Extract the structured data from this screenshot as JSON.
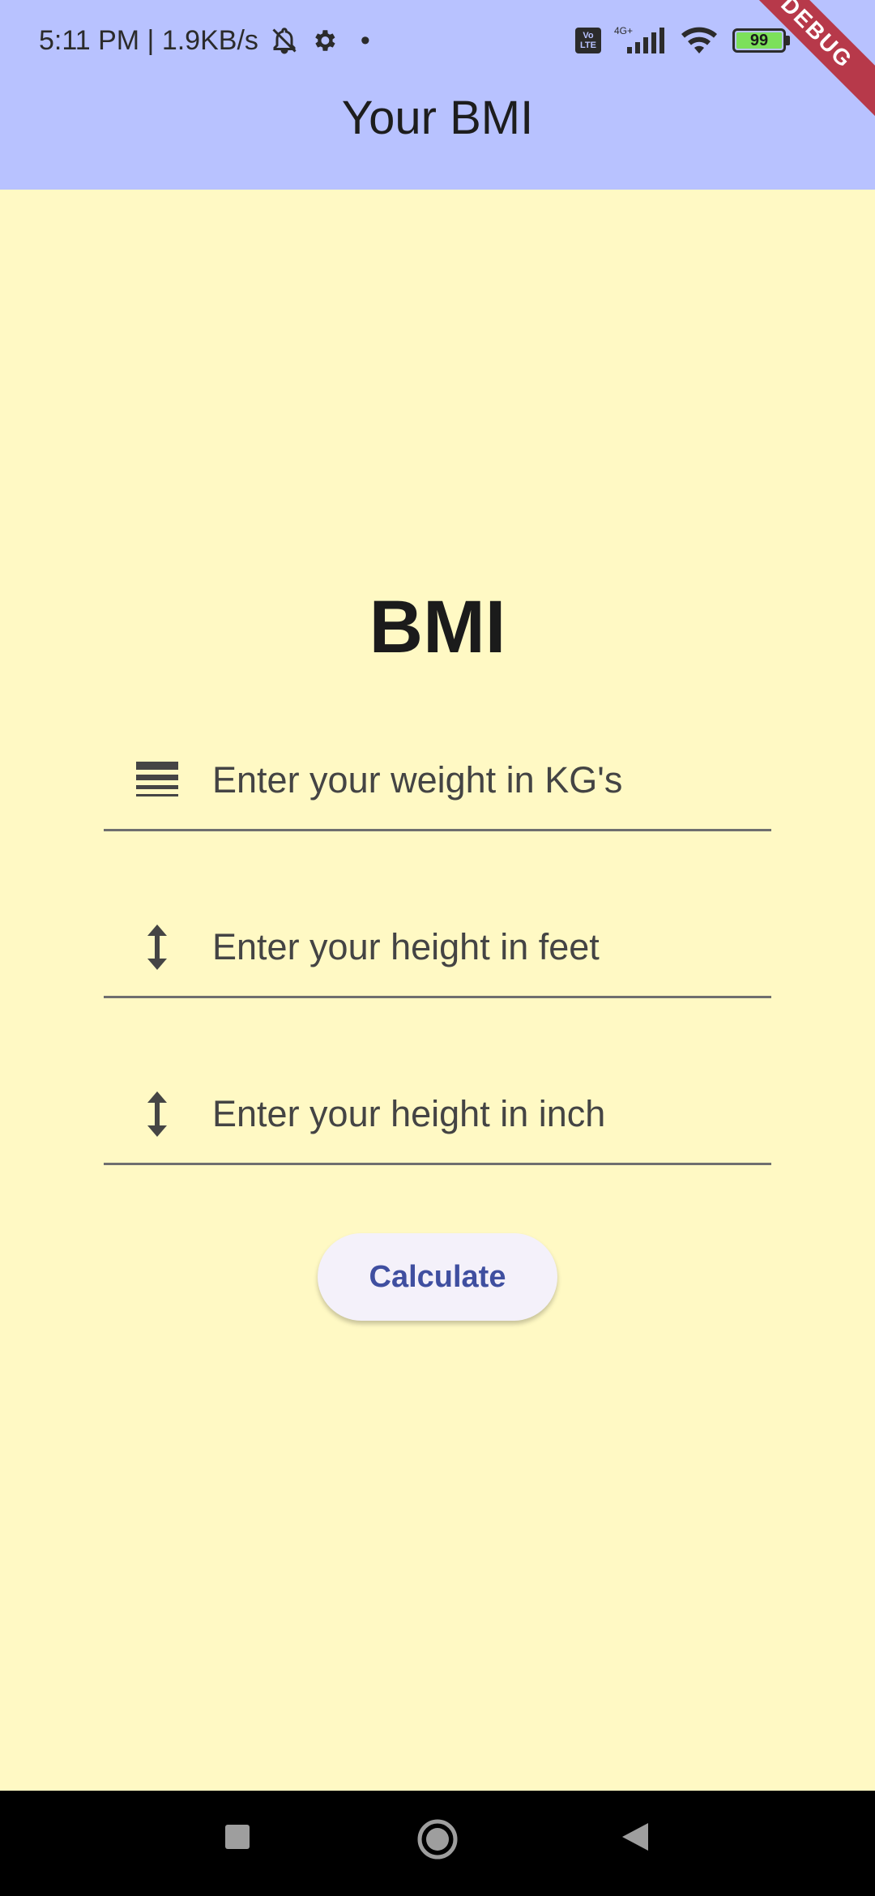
{
  "status_bar": {
    "time_speed": "5:11 PM | 1.9KB/s",
    "network": "4G+",
    "volte": "Vo LTE",
    "battery": "99"
  },
  "app_bar": {
    "title": "Your BMI",
    "debug_label": "DEBUG"
  },
  "main": {
    "heading": "BMI",
    "weight_placeholder": "Enter your weight in KG's",
    "height_feet_placeholder": "Enter your height in feet",
    "height_inch_placeholder": "Enter your height in inch",
    "calculate_label": "Calculate"
  },
  "icons": {
    "weight": "line-weight-icon",
    "height_feet": "height-icon",
    "height_inch": "height-icon"
  },
  "colors": {
    "app_bar": "#B8C2FF",
    "background": "#FFF9C4",
    "button_text": "#3F4FA0",
    "debug_ribbon": "#B7394A"
  }
}
